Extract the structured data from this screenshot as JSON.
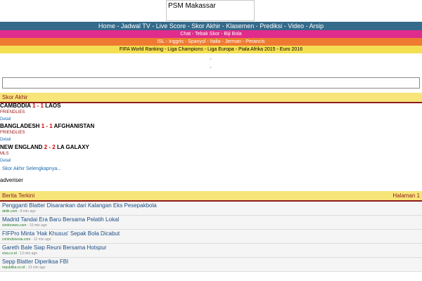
{
  "logo": {
    "text": "PSM Makassar"
  },
  "nav": {
    "main": "Home - Jadwal TV - Live Score - Skor Akhir - Klasemen - Prediksi - Video - Arsip",
    "sub1": "Chat - Tebak Skor - Biji Bola",
    "sub2": "ISL - Inggris - Spanyol - Italia - Jerman - Perancis",
    "sub3": "FIFA World Ranking - Liga Champions - Liga Europa - Piala Afrika 2015 - Euro 2016"
  },
  "dots": [
    "°",
    "°"
  ],
  "search": {
    "value": "",
    "placeholder": ""
  },
  "skor_akhir": {
    "title": "Skor Akhir",
    "matches": [
      {
        "home": "CAMBODIA",
        "hs": "1",
        "sep": " - ",
        "as": "1",
        "away": "LAOS",
        "league": "FRIENDLIES",
        "detail": "Detail"
      },
      {
        "home": "BANGLADESH",
        "hs": "1",
        "sep": " - ",
        "as": "1",
        "away": "AFGHANISTAN",
        "league": "FRIENDLIES",
        "detail": "Detail"
      },
      {
        "home": "NEW ENGLAND",
        "hs": "2",
        "sep": " - ",
        "as": "2",
        "away": "LA GALAXY",
        "league": "MLS",
        "detail": "Detail"
      }
    ],
    "more": "Skor Akhir Selengkapnya..."
  },
  "adviser": "adveriser",
  "berita": {
    "title": "Berita Terkini",
    "page": "Halaman 1",
    "items": [
      {
        "title": "Pengganti Blatter Disarankan dari Kalangan Eks Pesepakbola",
        "source": "detik.com",
        "ago": " - 8 min ago"
      },
      {
        "title": "Madrid Tandai Era Baru Bersama Pelatih Lokal",
        "source": "sindonews.com",
        "ago": " - 10 min ago"
      },
      {
        "title": "FIFPro Minta 'Hak Khusus' Sepak Bola Dicabut",
        "source": "cnnindonesia.com",
        "ago": " - 12 min ago"
      },
      {
        "title": "Gareth Bale Siap Reuni Bersama Hotspur",
        "source": "viva.co.id",
        "ago": " - 13 min ago"
      },
      {
        "title": "Sepp Blatter Diperiksa FBI",
        "source": "republika.co.id",
        "ago": " - 13 min ago"
      }
    ]
  }
}
